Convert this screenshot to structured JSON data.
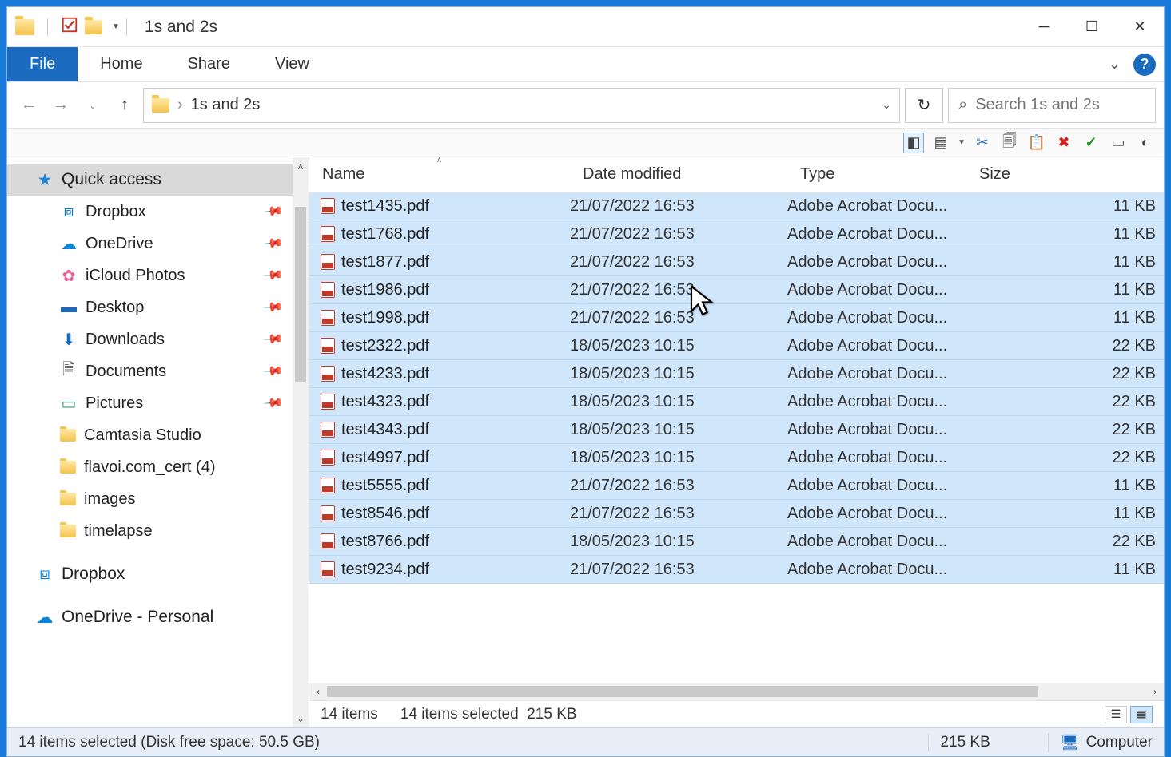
{
  "title": "1s and 2s",
  "ribbon": {
    "file": "File",
    "home": "Home",
    "share": "Share",
    "view": "View",
    "help": "?"
  },
  "address": {
    "folder": "1s and 2s",
    "search_placeholder": "Search 1s and 2s"
  },
  "sidebar": {
    "quick_access": "Quick access",
    "items": [
      {
        "label": "Dropbox",
        "pinned": true,
        "color": "#007ee5",
        "glyph": "⧈"
      },
      {
        "label": "OneDrive",
        "pinned": true,
        "color": "#0a84d6",
        "glyph": "☁"
      },
      {
        "label": "iCloud Photos",
        "pinned": true,
        "color": "#e85c9b",
        "glyph": "✿"
      },
      {
        "label": "Desktop",
        "pinned": true,
        "color": "#1a6bbf",
        "glyph": "▬"
      },
      {
        "label": "Downloads",
        "pinned": true,
        "color": "#1a6bbf",
        "glyph": "⬇"
      },
      {
        "label": "Documents",
        "pinned": true,
        "color": "#555",
        "glyph": "🗎"
      },
      {
        "label": "Pictures",
        "pinned": true,
        "color": "#2e9e6b",
        "glyph": "▭"
      },
      {
        "label": "Camtasia Studio",
        "pinned": false,
        "color": "#f5c24a",
        "glyph": "folder"
      },
      {
        "label": "flavoi.com_cert (4)",
        "pinned": false,
        "color": "#f5c24a",
        "glyph": "folder"
      },
      {
        "label": "images",
        "pinned": false,
        "color": "#f5c24a",
        "glyph": "folder"
      },
      {
        "label": "timelapse",
        "pinned": false,
        "color": "#f5c24a",
        "glyph": "folder"
      }
    ],
    "dropbox_root": "Dropbox",
    "onedrive_root": "OneDrive - Personal"
  },
  "columns": {
    "name": "Name",
    "date": "Date modified",
    "type": "Type",
    "size": "Size"
  },
  "files": [
    {
      "name": "test1435.pdf",
      "date": "21/07/2022 16:53",
      "type": "Adobe Acrobat Docu...",
      "size": "11 KB"
    },
    {
      "name": "test1768.pdf",
      "date": "21/07/2022 16:53",
      "type": "Adobe Acrobat Docu...",
      "size": "11 KB"
    },
    {
      "name": "test1877.pdf",
      "date": "21/07/2022 16:53",
      "type": "Adobe Acrobat Docu...",
      "size": "11 KB"
    },
    {
      "name": "test1986.pdf",
      "date": "21/07/2022 16:53",
      "type": "Adobe Acrobat Docu...",
      "size": "11 KB"
    },
    {
      "name": "test1998.pdf",
      "date": "21/07/2022 16:53",
      "type": "Adobe Acrobat Docu...",
      "size": "11 KB"
    },
    {
      "name": "test2322.pdf",
      "date": "18/05/2023 10:15",
      "type": "Adobe Acrobat Docu...",
      "size": "22 KB"
    },
    {
      "name": "test4233.pdf",
      "date": "18/05/2023 10:15",
      "type": "Adobe Acrobat Docu...",
      "size": "22 KB"
    },
    {
      "name": "test4323.pdf",
      "date": "18/05/2023 10:15",
      "type": "Adobe Acrobat Docu...",
      "size": "22 KB"
    },
    {
      "name": "test4343.pdf",
      "date": "18/05/2023 10:15",
      "type": "Adobe Acrobat Docu...",
      "size": "22 KB"
    },
    {
      "name": "test4997.pdf",
      "date": "18/05/2023 10:15",
      "type": "Adobe Acrobat Docu...",
      "size": "22 KB"
    },
    {
      "name": "test5555.pdf",
      "date": "21/07/2022 16:53",
      "type": "Adobe Acrobat Docu...",
      "size": "11 KB"
    },
    {
      "name": "test8546.pdf",
      "date": "21/07/2022 16:53",
      "type": "Adobe Acrobat Docu...",
      "size": "11 KB"
    },
    {
      "name": "test8766.pdf",
      "date": "18/05/2023 10:15",
      "type": "Adobe Acrobat Docu...",
      "size": "22 KB"
    },
    {
      "name": "test9234.pdf",
      "date": "21/07/2022 16:53",
      "type": "Adobe Acrobat Docu...",
      "size": "11 KB"
    }
  ],
  "status": {
    "count": "14 items",
    "selected": "14 items selected",
    "selsize": "215 KB"
  },
  "bottom": {
    "summary": "14 items selected (Disk free space: 50.5 GB)",
    "size": "215 KB",
    "location": "Computer"
  }
}
